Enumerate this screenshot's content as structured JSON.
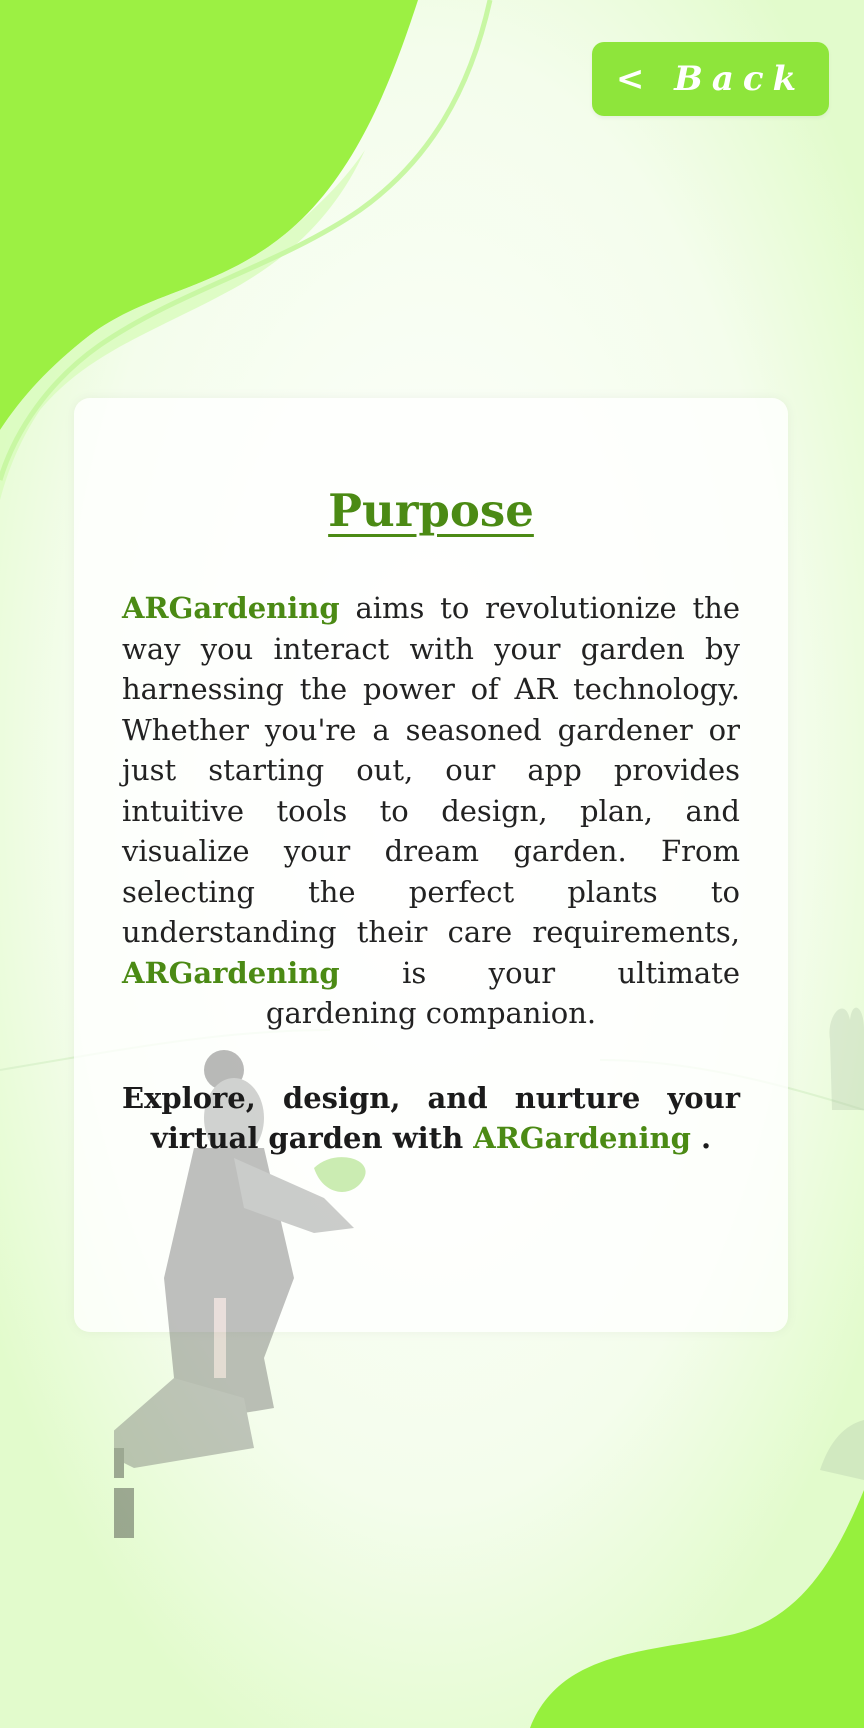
{
  "header": {
    "back_label": "< Back"
  },
  "purpose": {
    "title": "Purpose",
    "brand": "ARGardening",
    "paragraph_part1": " aims to revolutionize the way you interact with your garden by harnessing the power of AR technology. Whether you're a seasoned gardener or just starting out, our app provides intuitive tools to design, plan, and visualize your dream garden. From selecting the perfect plants to understanding their care requirements, ",
    "paragraph_part2": " is your ultimate gardening companion.",
    "tagline_part1": "Explore, design, and nurture your virtual garden with ",
    "tagline_end": " ."
  },
  "colors": {
    "accent": "#8ee53b",
    "brand_text": "#4b8a14",
    "background": "#f1fde8"
  },
  "icons": [
    "gardener-illustration"
  ]
}
